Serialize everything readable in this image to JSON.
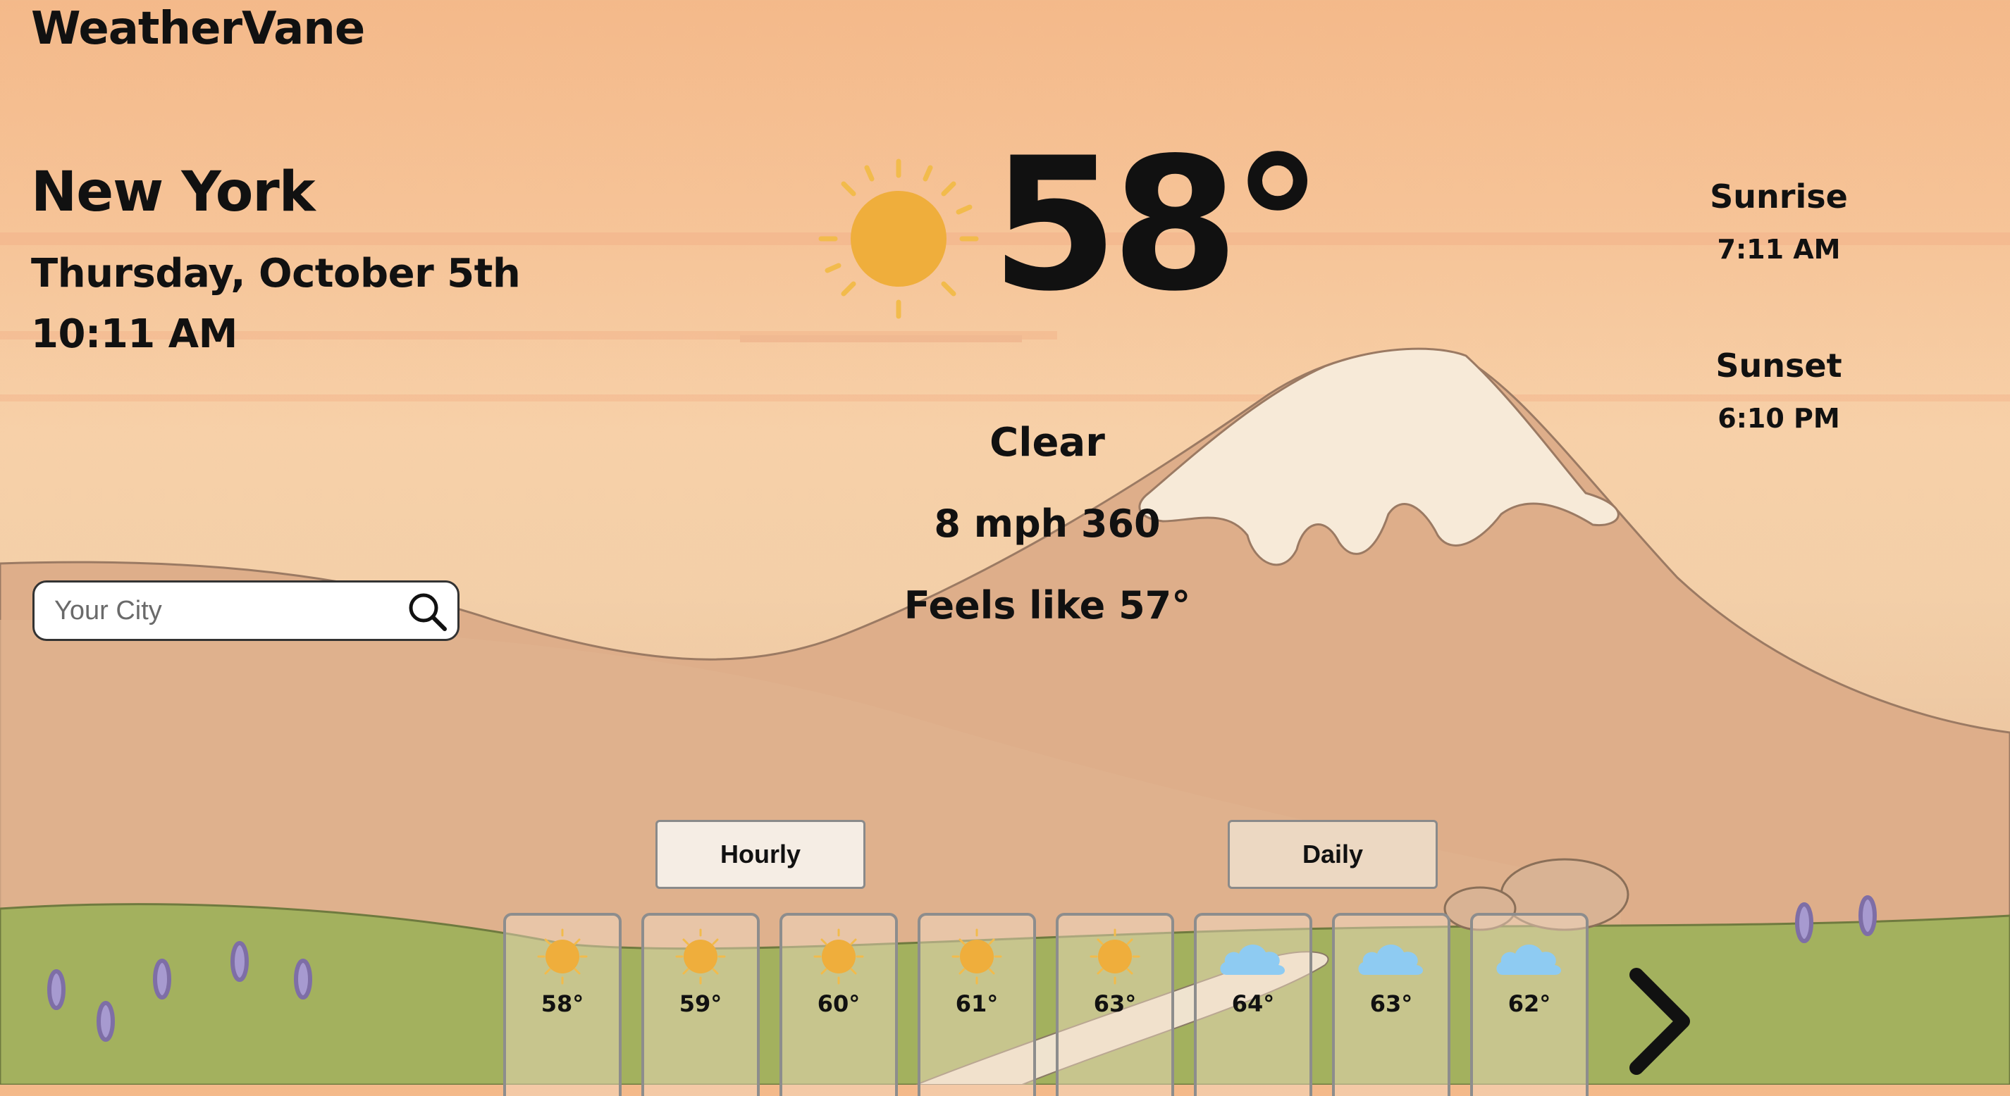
{
  "app": {
    "title": "WeatherVane"
  },
  "location": {
    "city": "New York",
    "date": "Thursday, October 5th",
    "time": "10:11 AM"
  },
  "search": {
    "placeholder": "Your City",
    "value": ""
  },
  "current": {
    "icon": "sun-icon",
    "temperature": "58°",
    "condition": "Clear",
    "wind": "8 mph 360",
    "feels_like": "Feels like 57°"
  },
  "sun": {
    "sunrise_label": "Sunrise",
    "sunrise_time": "7:11 AM",
    "sunset_label": "Sunset",
    "sunset_time": "6:10 PM"
  },
  "tabs": {
    "hourly": "Hourly",
    "daily": "Daily"
  },
  "forecast": [
    {
      "icon": "sun-icon",
      "temp": "58°"
    },
    {
      "icon": "sun-icon",
      "temp": "59°"
    },
    {
      "icon": "sun-icon",
      "temp": "60°"
    },
    {
      "icon": "sun-icon",
      "temp": "61°"
    },
    {
      "icon": "sun-icon",
      "temp": "63°"
    },
    {
      "icon": "cloud-icon",
      "temp": "64°"
    },
    {
      "icon": "cloud-icon",
      "temp": "63°"
    },
    {
      "icon": "cloud-icon",
      "temp": "62°"
    }
  ],
  "colors": {
    "sun": "#efae3c",
    "cloud": "#8ecbf2",
    "sky": "#f4b98a",
    "grass": "#9fae5a"
  }
}
